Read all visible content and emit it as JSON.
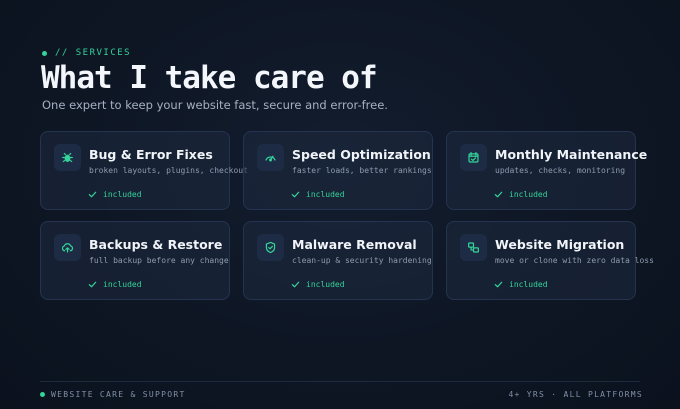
{
  "header": {
    "eyebrow": "// SERVICES",
    "title": "What I take care of",
    "subtitle": "One expert to keep your website fast, secure and error-free."
  },
  "colors": {
    "accent": "#34d399",
    "background": "#0e1624",
    "card": "#1d2a40"
  },
  "services": [
    {
      "icon": "bug-icon",
      "title": "Bug & Error Fixes",
      "desc": "broken layouts, plugins, checkout",
      "status": "included"
    },
    {
      "icon": "speedometer-icon",
      "title": "Speed Optimization",
      "desc": "faster loads, better rankings",
      "status": "included"
    },
    {
      "icon": "calendar-check-icon",
      "title": "Monthly Maintenance",
      "desc": "updates, checks, monitoring",
      "status": "included"
    },
    {
      "icon": "cloud-upload-icon",
      "title": "Backups & Restore",
      "desc": "full backup before any change",
      "status": "included"
    },
    {
      "icon": "shield-check-icon",
      "title": "Malware Removal",
      "desc": "clean-up & security hardening",
      "status": "included"
    },
    {
      "icon": "migration-icon",
      "title": "Website Migration",
      "desc": "move or clone with zero data loss",
      "status": "included"
    }
  ],
  "footer": {
    "left": "WEBSITE CARE & SUPPORT",
    "right": "4+ YRS · ALL PLATFORMS"
  }
}
